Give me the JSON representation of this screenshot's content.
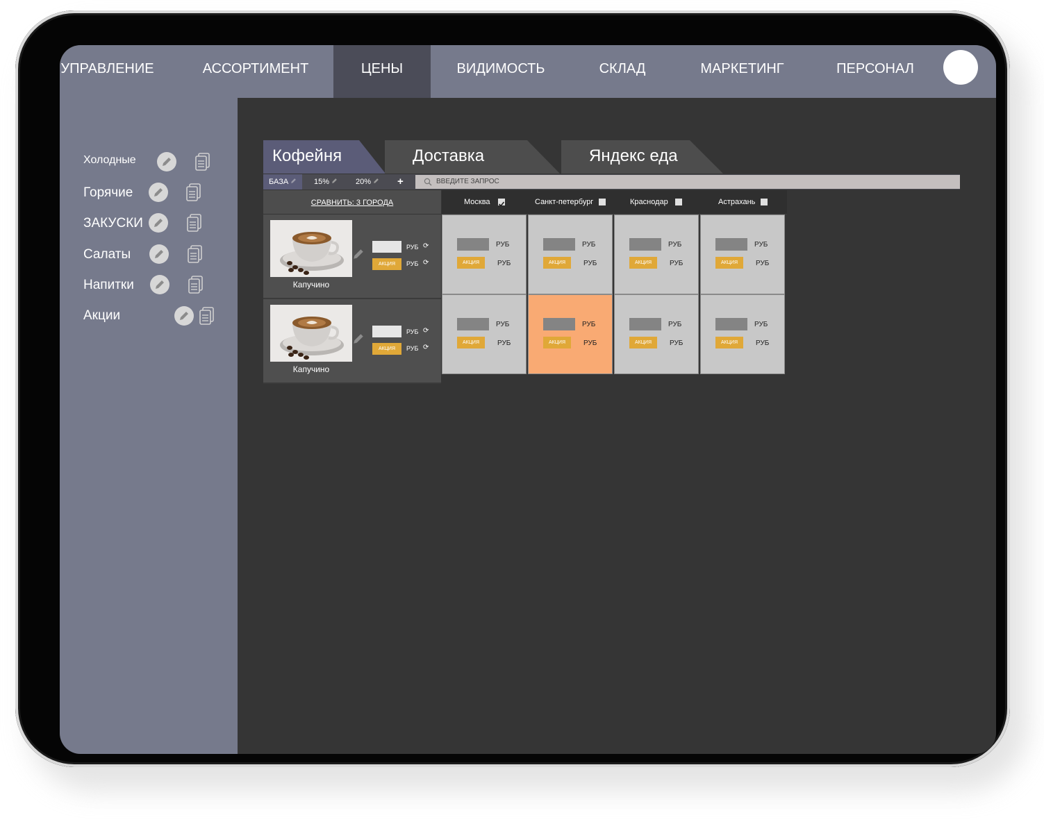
{
  "nav": {
    "items": [
      "УПРАВЛЕНИЕ",
      "АССОРТИМЕНТ",
      "ЦЕНЫ",
      "ВИДИМОСТЬ",
      "СКЛАД",
      "МАРКЕТИНГ",
      "ПЕРСОНАЛ"
    ],
    "active": "ЦЕНЫ"
  },
  "sidebar": {
    "categories": [
      "Холодные",
      "Горячие",
      "ЗАКУСКИ",
      "Салаты",
      "Напитки",
      "Акции"
    ]
  },
  "tabs": [
    "Кофейня",
    "Доставка",
    "Яндекс еда"
  ],
  "pricebar": {
    "base": "БАЗА",
    "p15": "15%",
    "p20": "20%",
    "add": "+",
    "search_placeholder": "ВВЕДИТЕ ЗАПРОС"
  },
  "compare": "СРАВНИТЬ: 3 ГОРОДА",
  "cities": [
    {
      "name": "Москва",
      "checked": true
    },
    {
      "name": "Санкт-петербург",
      "checked": false
    },
    {
      "name": "Краснодар",
      "checked": false
    },
    {
      "name": "Астрахань",
      "checked": false
    }
  ],
  "products": [
    {
      "name": "Капучино",
      "currency": "РУБ",
      "promo": "АКЦИЯ"
    },
    {
      "name": "Капучино",
      "currency": "РУБ",
      "promo": "АКЦИЯ"
    }
  ],
  "cell": {
    "currency": "РУБ",
    "promo": "АКЦИЯ"
  },
  "colors": {
    "nav": "#767a8c",
    "active_nav": "#4b4c58",
    "promo": "#e0a838",
    "highlight": "#f9aa73",
    "active_tab": "#5b5c78"
  }
}
